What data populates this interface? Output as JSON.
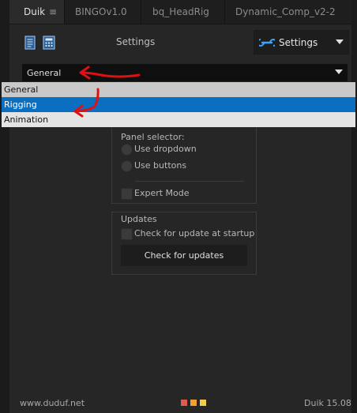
{
  "tabs": [
    {
      "label": "Duik",
      "menu_glyph": "≡",
      "active": true
    },
    {
      "label": "BINGOv1.0",
      "active": false
    },
    {
      "label": "bq_HeadRig",
      "active": false
    },
    {
      "label": "Dynamic_Comp_v2-2",
      "active": false
    }
  ],
  "toolbar": {
    "icon_left": "document-icon",
    "icon_right": "calculator-icon",
    "title": "Settings"
  },
  "settings_dropdown": {
    "label": "Settings",
    "icon": "wrench-icon"
  },
  "section_dropdown": {
    "selected": "General",
    "options": [
      "General",
      "Rigging",
      "Animation"
    ],
    "highlighted": "Rigging"
  },
  "ui_group": {
    "panel_selector_label": "Panel selector:",
    "use_dropdown": "Use dropdown",
    "use_buttons": "Use buttons",
    "expert_mode": "Expert Mode"
  },
  "updates_group": {
    "title": "Updates",
    "check_at_startup": "Check for update at startup",
    "check_button": "Check for updates"
  },
  "footer": {
    "url": "www.duduf.net",
    "version": "Duik 15.08",
    "colors": [
      "#e05a4e",
      "#f0a030",
      "#f0cc50"
    ]
  },
  "colors": {
    "background": "#262626",
    "highlight": "#0a6fc0",
    "annotation": "#e01010"
  }
}
